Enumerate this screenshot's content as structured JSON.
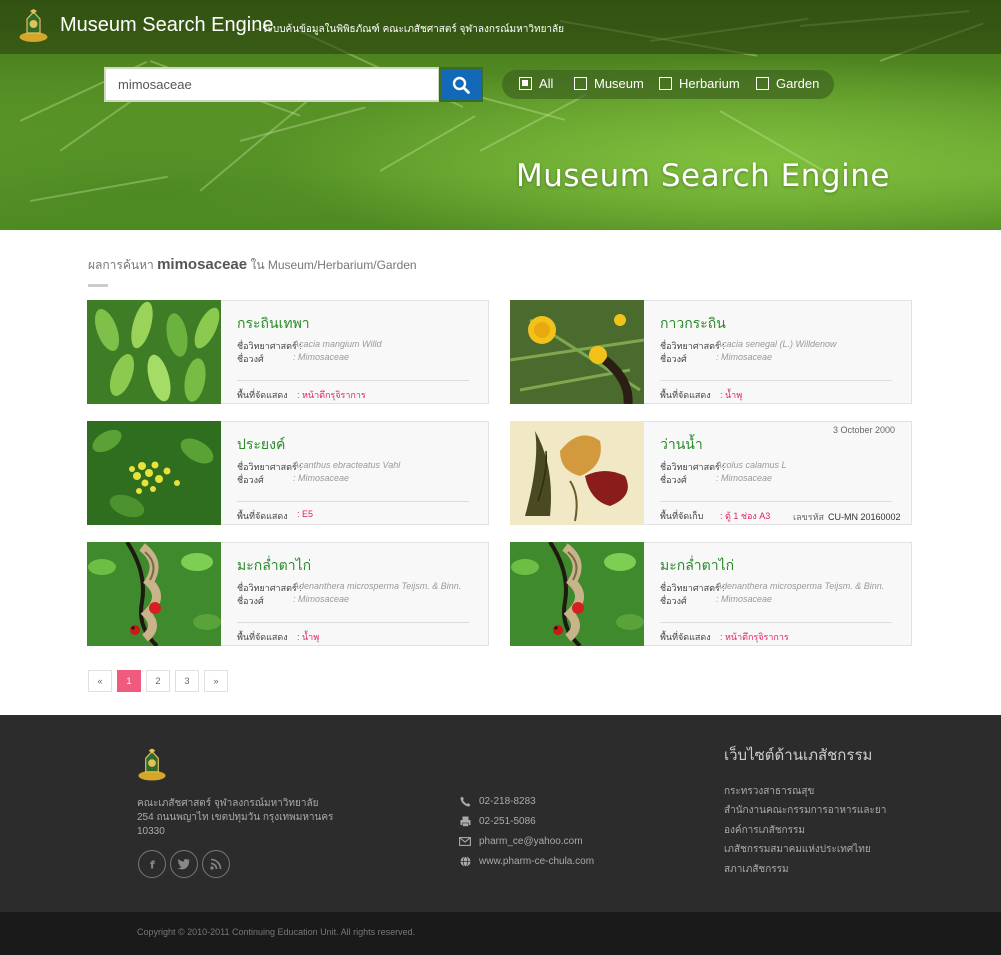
{
  "header": {
    "title": "Museum Search Engine",
    "subtitle": "- ระบบค้นข้อมูลในพิพิธภัณฑ์ คณะเภสัชศาสตร์ จุฬาลงกรณ์มหาวิทยาลัย",
    "hero_title": "Museum Search Engine"
  },
  "search": {
    "value": "mimosaceae",
    "filters": [
      {
        "label": "All",
        "checked": true
      },
      {
        "label": "Museum",
        "checked": false
      },
      {
        "label": "Herbarium",
        "checked": false
      },
      {
        "label": "Garden",
        "checked": false
      }
    ]
  },
  "results": {
    "prefix": "ผลการค้นหา",
    "keyword": "mimosaceae",
    "suffix": "ใน Museum/Herbarium/Garden",
    "labels": {
      "sci_name": "ชื่อวิทยาศาสตร์",
      "family": "ชื่อวงศ์",
      "location_display": "พื้นที่จัดแสดง",
      "location_store": "พื้นที่จัดเก็บ",
      "code": "เลขรหัส",
      "colon": ":"
    },
    "cards": [
      {
        "name": "กระถินเทพา",
        "sci": "Acacia mangium Willd",
        "family": "Mimosaceae",
        "loc_type": "display",
        "location": "หน้าตึกรุจิราการ",
        "date": "",
        "code": "",
        "image": "leaves"
      },
      {
        "name": "กาวกระถิน",
        "sci": "Acacia senegal (L.) Willdenow",
        "family": "Mimosaceae",
        "loc_type": "display",
        "location": "น้ำพุ",
        "date": "",
        "code": "",
        "image": "flower-yellow"
      },
      {
        "name": "ประยงค์",
        "sci": "Acanthus ebracteatus Vahl",
        "family": "Mimosaceae",
        "loc_type": "display",
        "location": "E5",
        "date": "",
        "code": "",
        "image": "berries"
      },
      {
        "name": "ว่านน้ำ",
        "sci": "Acolus calamus L",
        "family": "Mimosaceae",
        "loc_type": "store",
        "location": "ตู้ 1 ช่อง A3",
        "date": "3 October  2000",
        "code": "CU-MN 20160002",
        "image": "herbarium"
      },
      {
        "name": "มะกล่ำตาไก่",
        "sci": "Adenanthera microsperma Teijsm. & Binn.",
        "family": "Mimosaceae",
        "loc_type": "display",
        "location": "น้ำพุ",
        "date": "",
        "code": "",
        "image": "seedpod"
      },
      {
        "name": "มะกล่ำตาไก่",
        "sci": "Adenanthera microsperma Teijsm. & Binn.",
        "family": "Mimosaceae",
        "loc_type": "display",
        "location": "หน้าตึกรุจิราการ",
        "date": "",
        "code": "",
        "image": "seedpod"
      }
    ]
  },
  "pagination": {
    "prev": "«",
    "pages": [
      "1",
      "2",
      "3"
    ],
    "active": "1",
    "next": "»"
  },
  "footer": {
    "address_lines": [
      "คณะเภสัชศาสตร์ จุฬาลงกรณ์มหาวิทยาลัย",
      "254 ถนนพญาไท เขตปทุมวัน กรุงเทพมหานคร",
      "10330"
    ],
    "social": [
      {
        "icon": "facebook-icon",
        "glyph": "f"
      },
      {
        "icon": "twitter-icon",
        "glyph": "t"
      },
      {
        "icon": "rss-icon",
        "glyph": "rss"
      }
    ],
    "contacts": [
      {
        "icon": "phone-icon",
        "text": "02-218-8283"
      },
      {
        "icon": "fax-icon",
        "text": "02-251-5086"
      },
      {
        "icon": "mail-icon",
        "text": "pharm_ce@yahoo.com"
      },
      {
        "icon": "globe-icon",
        "text": "www.pharm-ce-chula.com"
      }
    ],
    "links_title": "เว็บไซต์ด้านเภสัชกรรม",
    "links": [
      "กระทรวงสาธารณสุข",
      "สำนักงานคณะกรรมการอาหารและยา",
      "องค์การเภสัชกรรม",
      "เภสัชกรรมสมาคมแห่งประเทศไทย",
      "สภาเภสัชกรรม"
    ],
    "copyright": "Copyright © 2010-2011 Continuing Education Unit. All rights reserved."
  },
  "colors": {
    "accent_blue": "#1468b8",
    "title_green": "#2a8a2a",
    "location_pink": "#e0245e",
    "active_page": "#ef5a7d"
  }
}
